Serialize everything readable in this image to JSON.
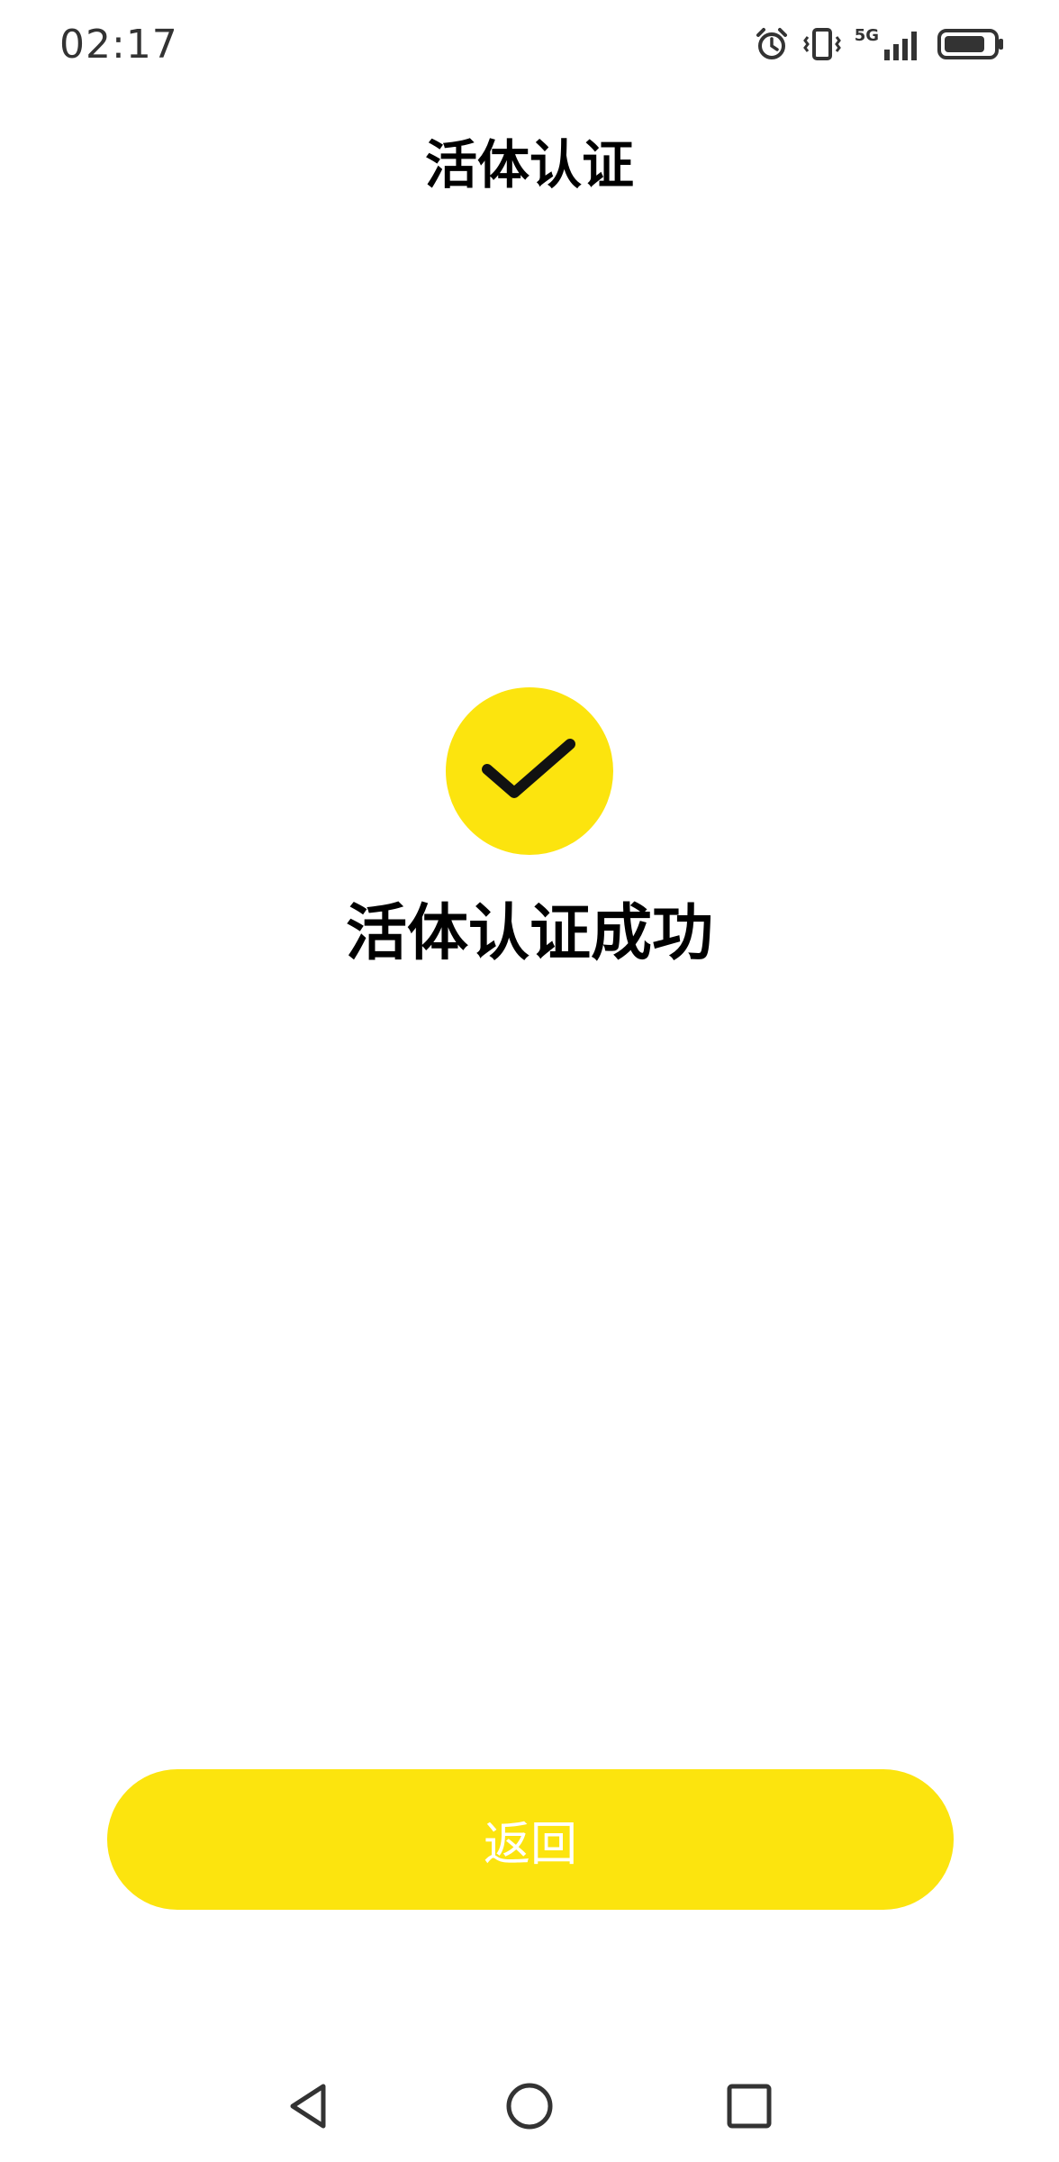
{
  "status_bar": {
    "time": "02:17",
    "icons": [
      "alarm-icon",
      "vibrate-icon",
      "5g-signal-icon",
      "battery-icon"
    ],
    "network_label": "5G"
  },
  "header": {
    "title": "活体认证"
  },
  "result": {
    "icon": "checkmark-icon",
    "message": "活体认证成功"
  },
  "actions": {
    "return_label": "返回"
  },
  "nav_bar": {
    "icons": [
      "back-triangle-icon",
      "home-circle-icon",
      "recents-square-icon"
    ]
  },
  "colors": {
    "accent": "#FCE40E",
    "text_primary": "#000000",
    "button_text": "#FFFFFF",
    "status_text": "#333333"
  }
}
